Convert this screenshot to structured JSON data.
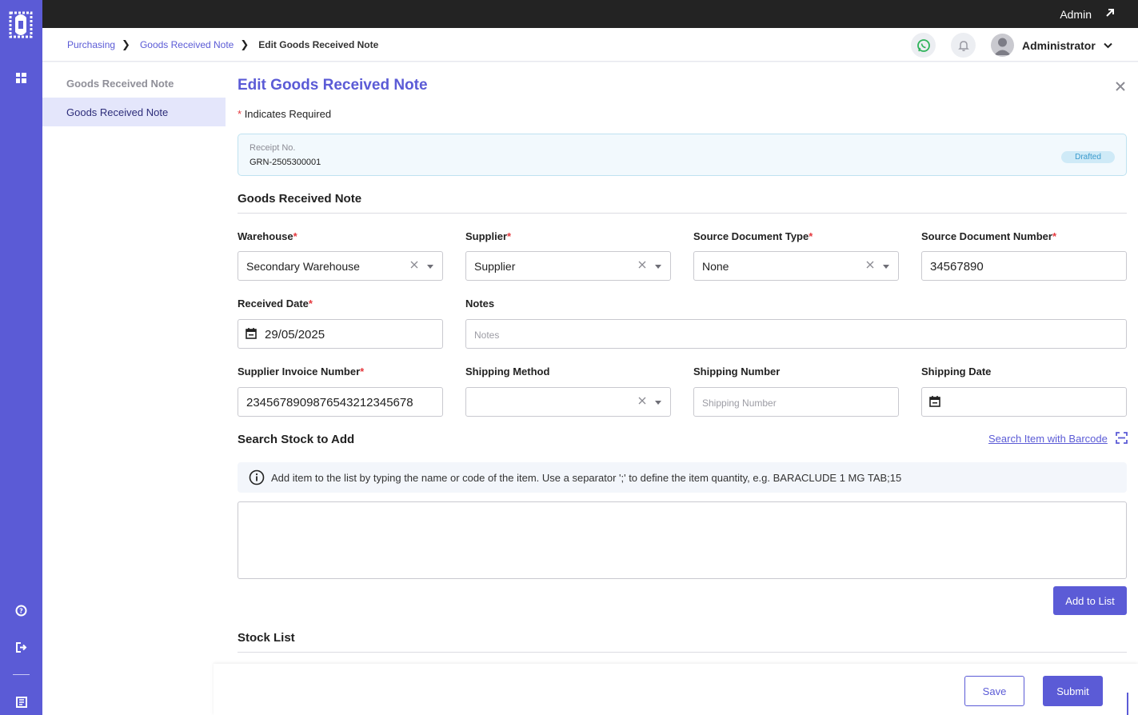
{
  "app": {
    "admin_label": "Admin",
    "colors": {
      "accent": "#5b5bd6",
      "rail": "#5b5bd6",
      "topbar": "#232323",
      "required": "#e5393e",
      "badge_bg": "#cfeaf7",
      "badge_text": "#3a9acd"
    }
  },
  "breadcrumb": {
    "items": [
      "Purchasing",
      "Goods Received Note"
    ],
    "current": "Edit Goods Received Note"
  },
  "header": {
    "user_name": "Administrator",
    "icons": [
      "whatsapp-icon",
      "bell-icon",
      "user-avatar-icon",
      "chevron-down-icon"
    ]
  },
  "rail": {
    "icons": [
      "logo-icon",
      "dashboard-grid-icon",
      "help-icon",
      "logout-icon",
      "book-icon"
    ]
  },
  "sidebar": {
    "heading": "Goods Received Note",
    "items": [
      {
        "label": "Goods Received Note",
        "active": true
      }
    ]
  },
  "form": {
    "title": "Edit Goods Received Note",
    "required_note": "Indicates Required",
    "required_marker": "*",
    "receipt": {
      "label": "Receipt No.",
      "value": "GRN-2505300001",
      "status": "Drafted"
    },
    "section_title": "Goods Received Note",
    "fields": {
      "warehouse": {
        "label": "Warehouse",
        "value": "Secondary Warehouse",
        "required": true
      },
      "supplier": {
        "label": "Supplier",
        "value": "Supplier",
        "required": true
      },
      "source_doc_type": {
        "label": "Source Document Type",
        "value": "None",
        "required": true
      },
      "source_doc_number": {
        "label": "Source Document Number",
        "value": "34567890",
        "required": true
      },
      "received_date": {
        "label": "Received Date",
        "value": "29/05/2025",
        "required": true
      },
      "notes": {
        "label": "Notes",
        "value": "",
        "placeholder": "Notes"
      },
      "supplier_invoice": {
        "label": "Supplier Invoice Number",
        "value": "23456789098765432123456​78",
        "required": true
      },
      "shipping_method": {
        "label": "Shipping Method",
        "value": ""
      },
      "shipping_number": {
        "label": "Shipping Number",
        "value": "",
        "placeholder": "Shipping Number"
      },
      "shipping_date": {
        "label": "Shipping Date",
        "value": ""
      }
    }
  },
  "stock_search": {
    "title": "Search Stock to Add",
    "barcode_link": "Search Item with Barcode",
    "info": "Add item to the list by typing the name or code of the item. Use a separator ';' to define the item quantity, e.g. BARACLUDE 1 MG TAB;15",
    "add_button": "Add to List"
  },
  "stock_list": {
    "title": "Stock List"
  },
  "footer": {
    "save_label": "Save",
    "submit_label": "Submit"
  }
}
